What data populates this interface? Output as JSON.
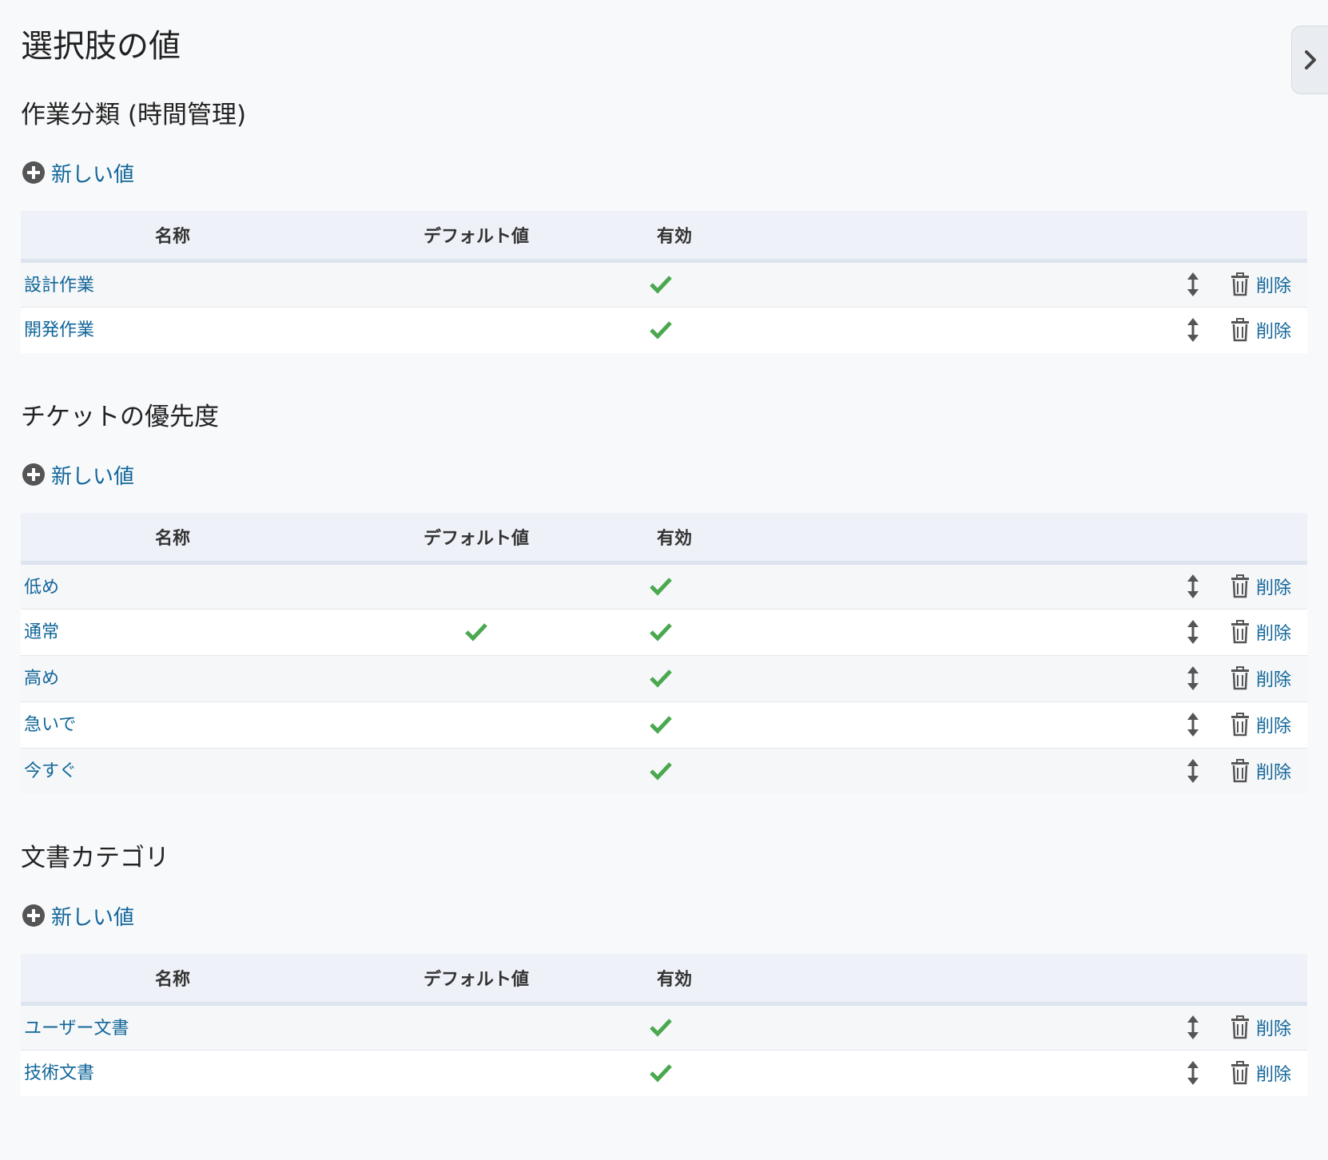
{
  "page": {
    "title": "選択肢の値"
  },
  "columns": {
    "name": "名称",
    "default": "デフォルト値",
    "active": "有効"
  },
  "labels": {
    "new_value": "新しい値",
    "delete": "削除"
  },
  "colors": {
    "link": "#116699",
    "check": "#4aa84f",
    "header_bg": "#eef1f7"
  },
  "icons": {
    "toggle": "chevron-right-icon",
    "add": "plus-circle-icon",
    "sort": "up-down-arrow-icon",
    "delete": "trash-icon",
    "check": "checkmark-icon"
  },
  "sections": [
    {
      "title": "作業分類 (時間管理)",
      "rows": [
        {
          "name": "設計作業",
          "default": false,
          "active": true
        },
        {
          "name": "開発作業",
          "default": false,
          "active": true
        }
      ]
    },
    {
      "title": "チケットの優先度",
      "rows": [
        {
          "name": "低め",
          "default": false,
          "active": true
        },
        {
          "name": "通常",
          "default": true,
          "active": true
        },
        {
          "name": "高め",
          "default": false,
          "active": true
        },
        {
          "name": "急いで",
          "default": false,
          "active": true
        },
        {
          "name": "今すぐ",
          "default": false,
          "active": true
        }
      ]
    },
    {
      "title": "文書カテゴリ",
      "rows": [
        {
          "name": "ユーザー文書",
          "default": false,
          "active": true
        },
        {
          "name": "技術文書",
          "default": false,
          "active": true
        }
      ]
    }
  ]
}
